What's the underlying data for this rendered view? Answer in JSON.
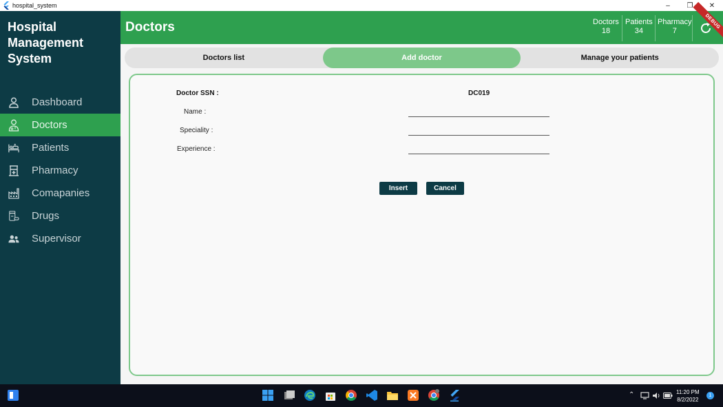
{
  "window": {
    "title": "hospital_system"
  },
  "sidebar": {
    "app_name": "Hospital Management System",
    "items": [
      {
        "label": "Dashboard",
        "icon": "person-icon"
      },
      {
        "label": "Doctors",
        "icon": "doctor-icon",
        "active": true
      },
      {
        "label": "Patients",
        "icon": "hospital-bed-icon"
      },
      {
        "label": "Pharmacy",
        "icon": "pharmacy-icon"
      },
      {
        "label": "Comapanies",
        "icon": "factory-icon"
      },
      {
        "label": "Drugs",
        "icon": "drugs-icon"
      },
      {
        "label": "Supervisor",
        "icon": "supervisor-icon"
      }
    ]
  },
  "header": {
    "title": "Doctors",
    "stats": [
      {
        "label": "Doctors",
        "value": "18"
      },
      {
        "label": "Patients",
        "value": "34"
      },
      {
        "label": "Pharmacy",
        "value": "7"
      }
    ],
    "debug_banner": "DEBUG"
  },
  "tabs": [
    {
      "label": "Doctors list"
    },
    {
      "label": "Add doctor",
      "active": true
    },
    {
      "label": "Manage your patients"
    }
  ],
  "form": {
    "ssn_label": "Doctor SSN :",
    "ssn_value": "DC019",
    "name_label": "Name :",
    "name_value": "",
    "speciality_label": "Speciality :",
    "speciality_value": "",
    "experience_label": "Experience :",
    "experience_value": "",
    "insert_label": "Insert",
    "cancel_label": "Cancel"
  },
  "taskbar": {
    "time": "11:20 PM",
    "date": "8/2/2022",
    "notification_count": "1"
  },
  "colors": {
    "sidebar_bg": "#0d3b45",
    "accent_green": "#2ea04f",
    "active_tab": "#7dc88a",
    "button_bg": "#0d3b45"
  }
}
